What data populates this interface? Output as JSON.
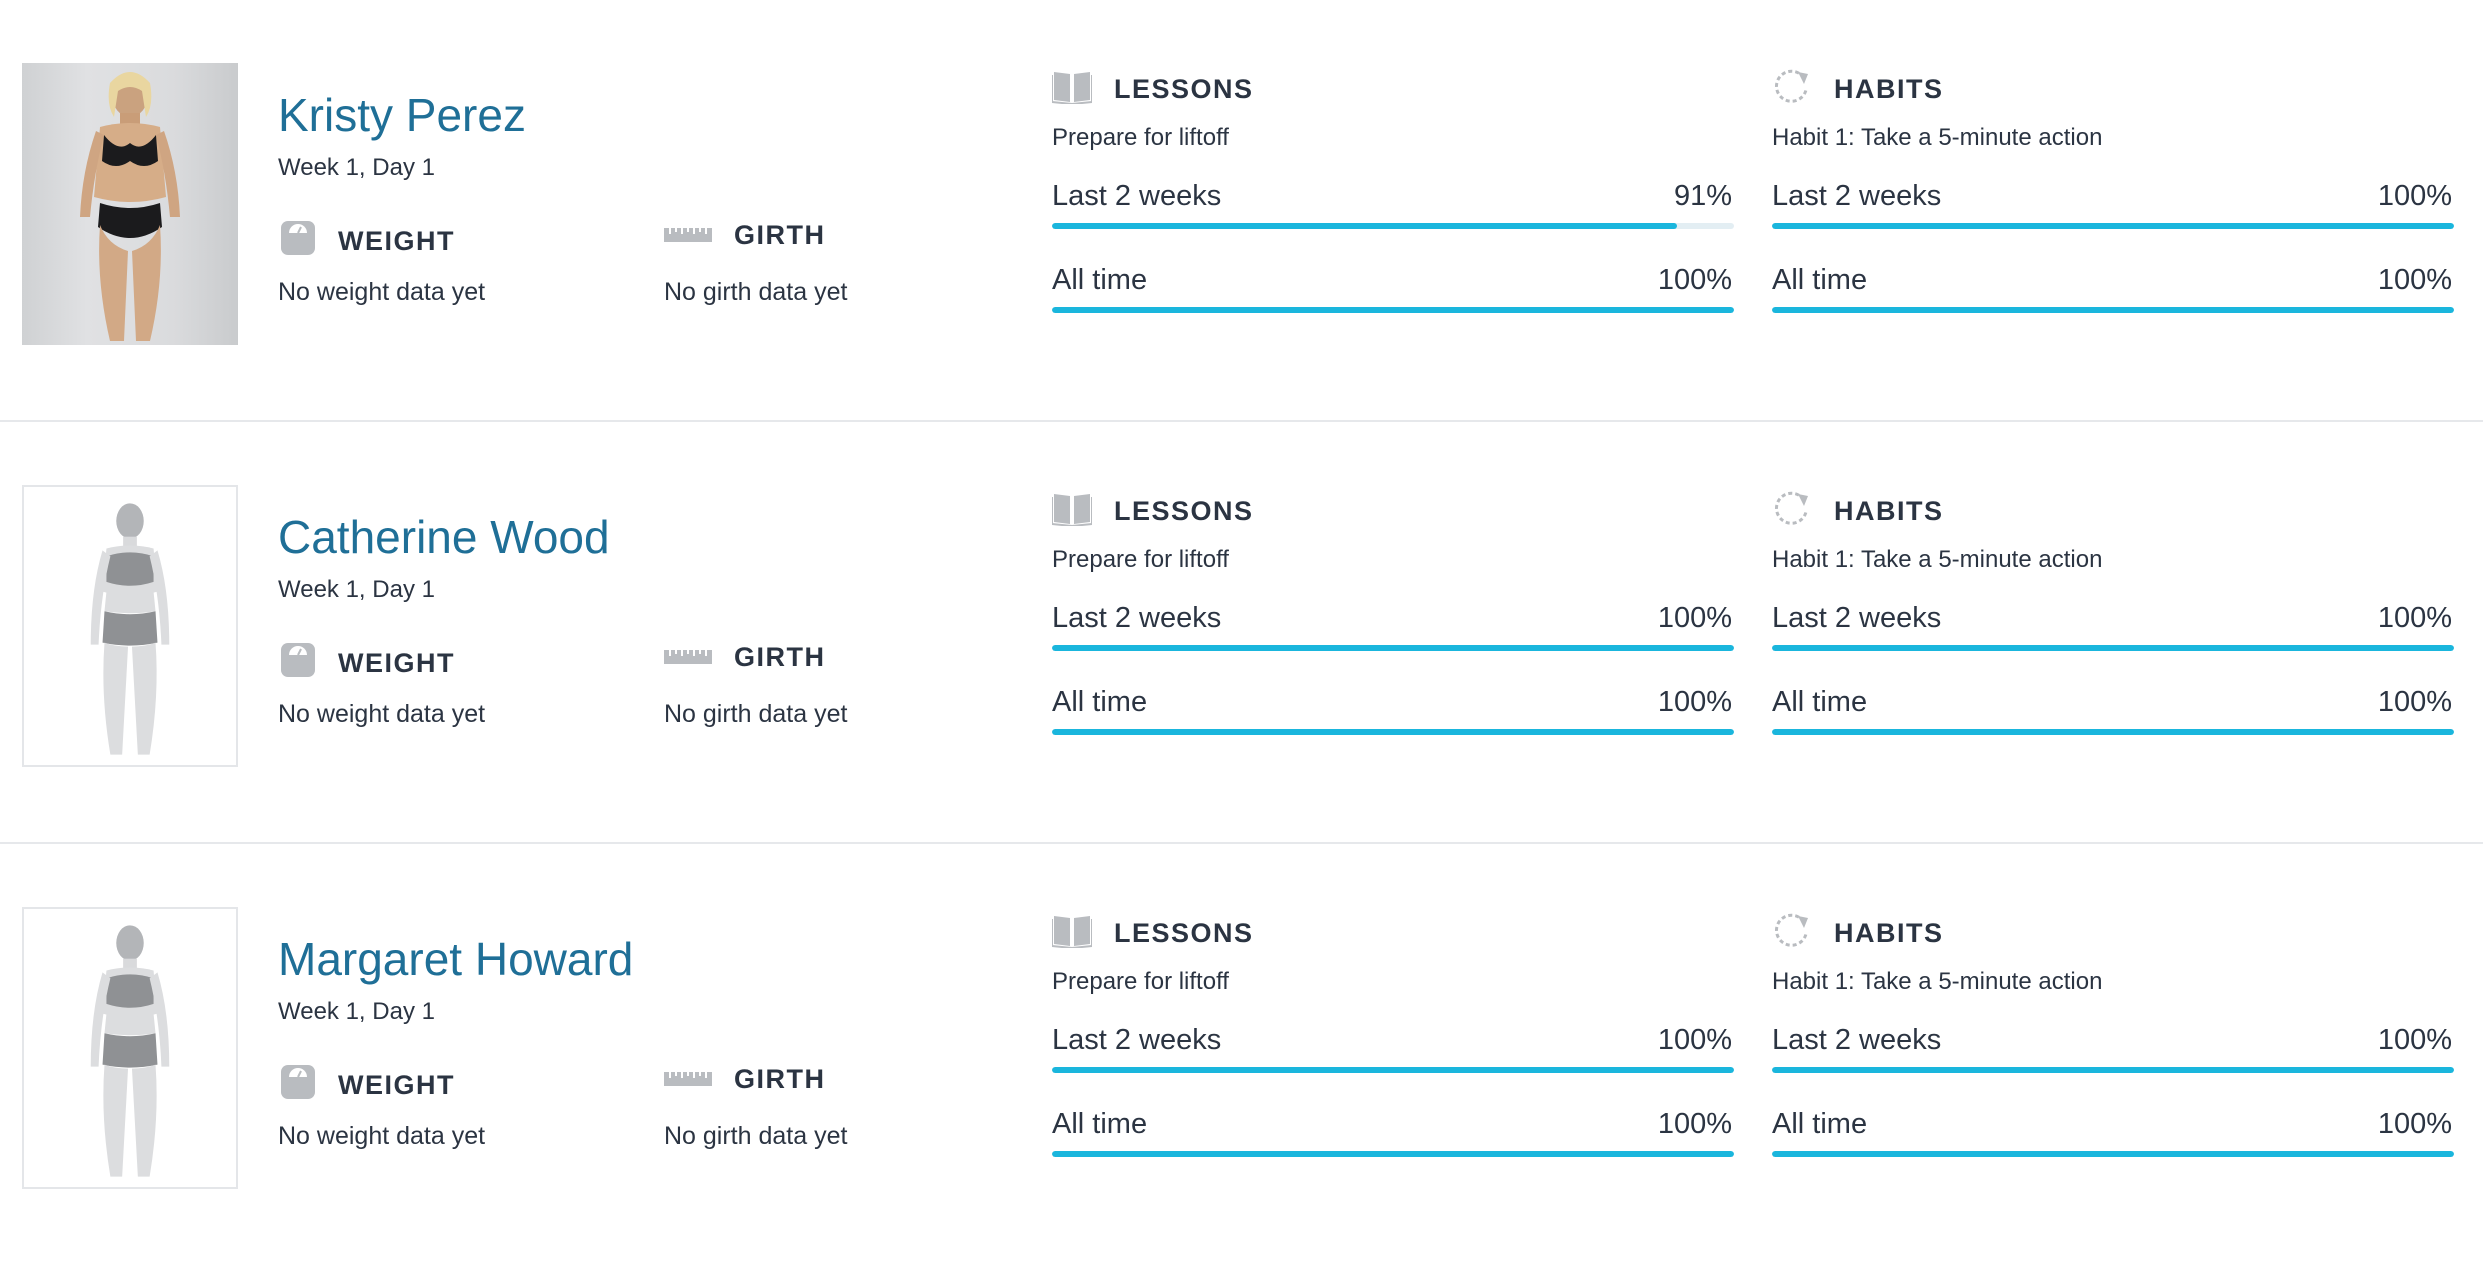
{
  "clients": [
    {
      "name": "Kristy Perez",
      "progress_day": "Week 1, Day 1",
      "photo": "real",
      "weight": {
        "label": "WEIGHT",
        "value": "No weight data yet",
        "icon": "scale-icon"
      },
      "girth": {
        "label": "GIRTH",
        "value": "No girth data yet",
        "icon": "ruler-icon"
      },
      "lessons": {
        "label": "LESSONS",
        "icon": "book-icon",
        "current": "Prepare for liftoff",
        "metrics": [
          {
            "label": "Last 2 weeks",
            "value": "91%",
            "fraction": 0.917
          },
          {
            "label": "All time",
            "value": "100%",
            "fraction": 1.0
          }
        ]
      },
      "habits": {
        "label": "HABITS",
        "icon": "refresh-icon",
        "current": "Habit 1: Take a 5-minute action",
        "metrics": [
          {
            "label": "Last 2 weeks",
            "value": "100%",
            "fraction": 1.0
          },
          {
            "label": "All time",
            "value": "100%",
            "fraction": 1.0
          }
        ]
      }
    },
    {
      "name": "Catherine Wood",
      "progress_day": "Week 1, Day 1",
      "photo": "placeholder",
      "weight": {
        "label": "WEIGHT",
        "value": "No weight data yet",
        "icon": "scale-icon"
      },
      "girth": {
        "label": "GIRTH",
        "value": "No girth data yet",
        "icon": "ruler-icon"
      },
      "lessons": {
        "label": "LESSONS",
        "icon": "book-icon",
        "current": "Prepare for liftoff",
        "metrics": [
          {
            "label": "Last 2 weeks",
            "value": "100%",
            "fraction": 1.0
          },
          {
            "label": "All time",
            "value": "100%",
            "fraction": 1.0
          }
        ]
      },
      "habits": {
        "label": "HABITS",
        "icon": "refresh-icon",
        "current": "Habit 1: Take a 5-minute action",
        "metrics": [
          {
            "label": "Last 2 weeks",
            "value": "100%",
            "fraction": 1.0
          },
          {
            "label": "All time",
            "value": "100%",
            "fraction": 1.0
          }
        ]
      }
    },
    {
      "name": "Margaret Howard",
      "progress_day": "Week 1, Day 1",
      "photo": "placeholder",
      "weight": {
        "label": "WEIGHT",
        "value": "No weight data yet",
        "icon": "scale-icon"
      },
      "girth": {
        "label": "GIRTH",
        "value": "No girth data yet",
        "icon": "ruler-icon"
      },
      "lessons": {
        "label": "LESSONS",
        "icon": "book-icon",
        "current": "Prepare for liftoff",
        "metrics": [
          {
            "label": "Last 2 weeks",
            "value": "100%",
            "fraction": 1.0
          },
          {
            "label": "All time",
            "value": "100%",
            "fraction": 1.0
          }
        ]
      },
      "habits": {
        "label": "HABITS",
        "icon": "refresh-icon",
        "current": "Habit 1: Take a 5-minute action",
        "metrics": [
          {
            "label": "Last 2 weeks",
            "value": "100%",
            "fraction": 1.0
          },
          {
            "label": "All time",
            "value": "100%",
            "fraction": 1.0
          }
        ]
      }
    }
  ],
  "colors": {
    "name": "#1f6f97",
    "text": "#2b3442",
    "bar": "#1ab6dd",
    "icon": "#b9bcc0",
    "divider": "#e6e8eb"
  }
}
